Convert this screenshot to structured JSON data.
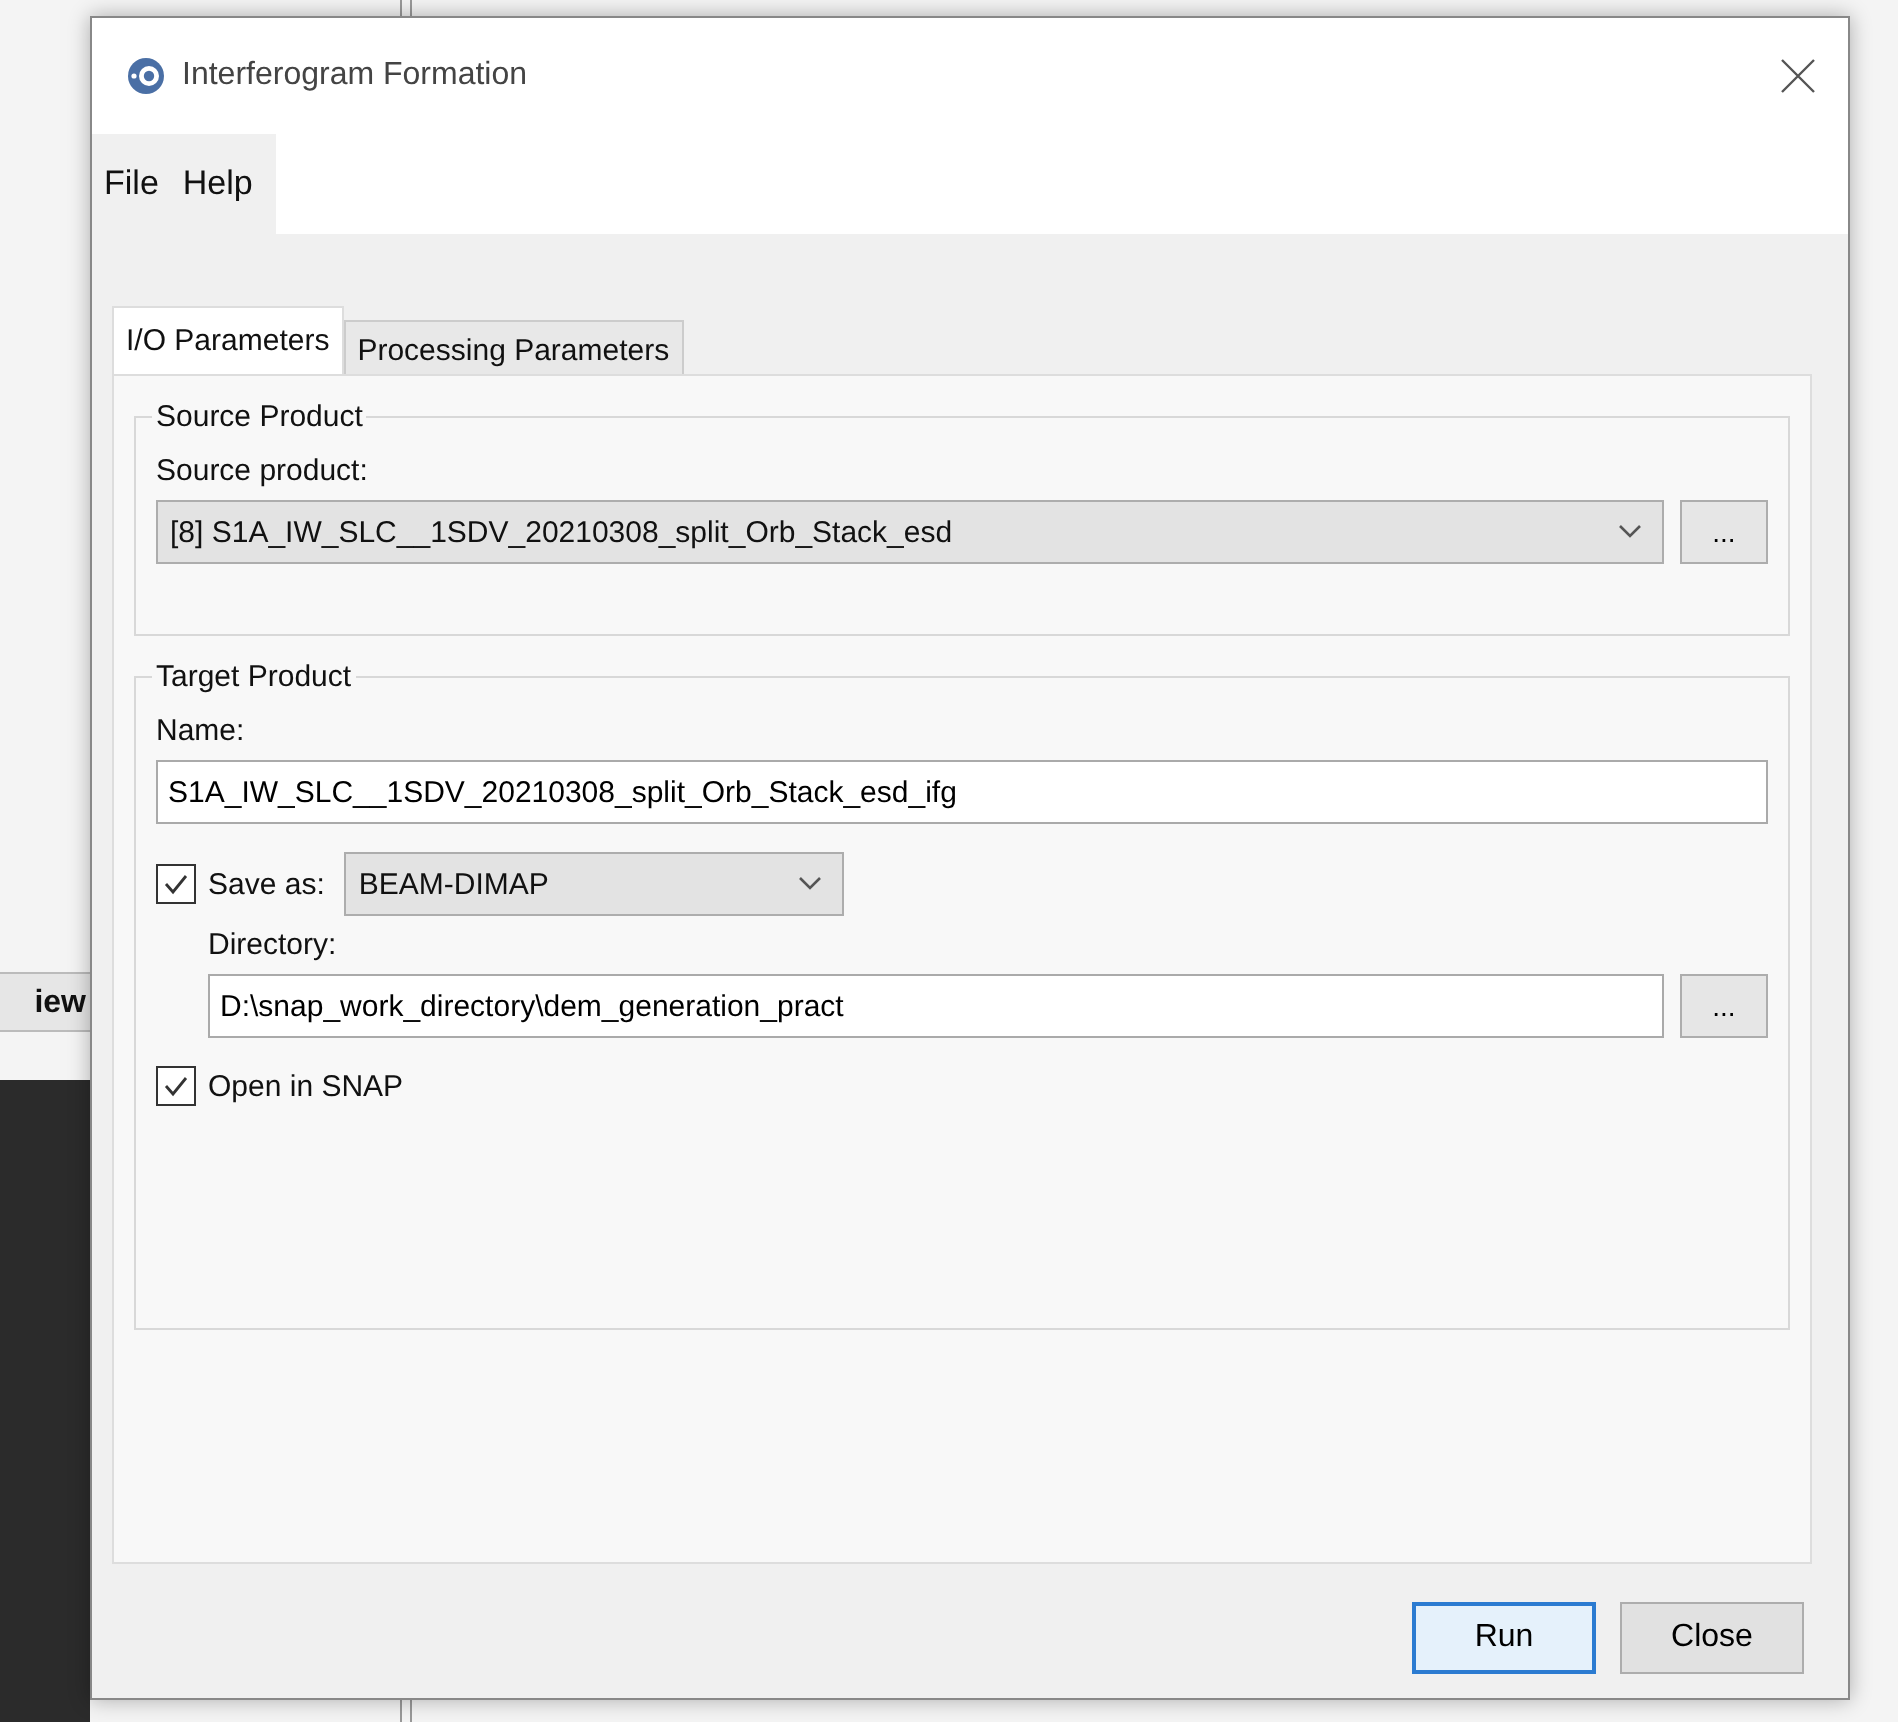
{
  "background_app": {
    "tab_label": "iew"
  },
  "window": {
    "title": "Interferogram Formation"
  },
  "menu": [
    "File",
    "Help"
  ],
  "tabs": [
    {
      "label": "I/O Parameters",
      "selected": true
    },
    {
      "label": "Processing Parameters",
      "selected": false
    }
  ],
  "source_product": {
    "title": "Source Product",
    "label": "Source product:",
    "value": "[8] S1A_IW_SLC__1SDV_20210308_split_Orb_Stack_esd",
    "browse_button": "..."
  },
  "target_product": {
    "title": "Target Product",
    "name_label": "Name:",
    "name_value": "S1A_IW_SLC__1SDV_20210308_split_Orb_Stack_esd_ifg",
    "save_as": {
      "label": "Save as:",
      "checked": true,
      "format": "BEAM-DIMAP"
    },
    "directory_label": "Directory:",
    "directory_value": "D:\\snap_work_directory\\dem_generation_pract",
    "browse_button": "...",
    "open_in_snap": {
      "label": "Open in SNAP",
      "checked": true
    }
  },
  "buttons": [
    {
      "label": "Run",
      "default": true
    },
    {
      "label": "Close",
      "default": false
    }
  ]
}
